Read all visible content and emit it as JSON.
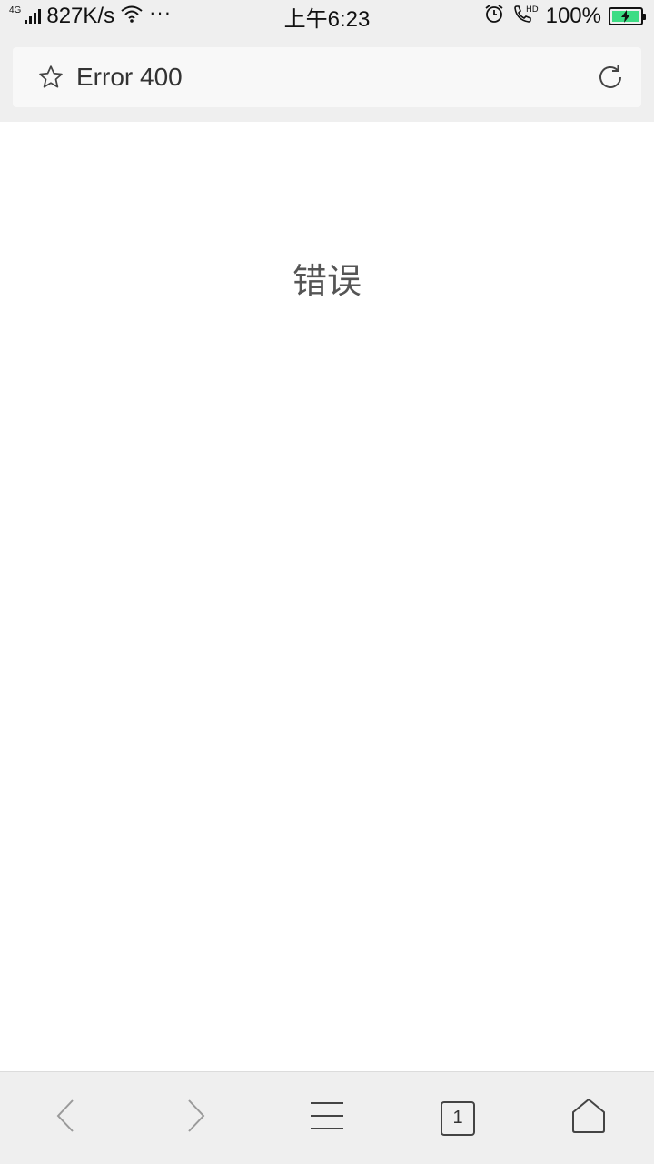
{
  "status_bar": {
    "network_type": "4G",
    "speed": "827K/s",
    "more_dots": "···",
    "time": "上午6:23",
    "battery_percent": "100%",
    "battery_level": 1.0,
    "battery_color": "#3ddc84",
    "icons": [
      "signal-bars-icon",
      "wifi-icon",
      "alarm-icon",
      "hd-call-icon",
      "battery-charging-icon"
    ]
  },
  "address_bar": {
    "title": "Error 400",
    "icons": [
      "star-icon",
      "reload-icon"
    ]
  },
  "page": {
    "message": "错误"
  },
  "toolbar": {
    "tab_count": "1",
    "icons": [
      "back-icon",
      "forward-icon",
      "menu-icon",
      "tabs-icon",
      "home-icon"
    ]
  }
}
